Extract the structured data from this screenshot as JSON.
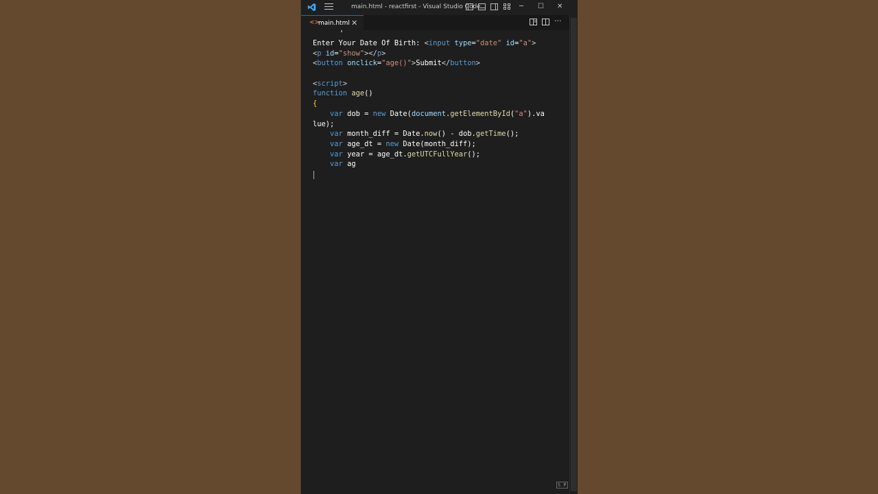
{
  "window": {
    "title": "main.html - reactfirst - Visual Studio Code",
    "controls": {
      "minimize": "─",
      "maximize": "☐",
      "close": "✕"
    }
  },
  "tab": {
    "icon": "<>",
    "label": "main.html",
    "close": "✕"
  },
  "editor_actions": [
    "open-preview-icon",
    "split-editor-icon",
    "more-actions-icon"
  ],
  "code": {
    "lines": [
      [
        {
          "t": "Enter Your Date Of Birth: ",
          "c": "text"
        },
        {
          "t": "<",
          "c": "tag"
        },
        {
          "t": "input",
          "c": "kw"
        },
        {
          "t": " type",
          "c": "attr"
        },
        {
          "t": "=",
          "c": "text"
        },
        {
          "t": "\"date\"",
          "c": "str"
        },
        {
          "t": " id",
          "c": "attr"
        },
        {
          "t": "=",
          "c": "text"
        },
        {
          "t": "\"a\"",
          "c": "str"
        },
        {
          "t": ">",
          "c": "tag"
        }
      ],
      [
        {
          "t": "<",
          "c": "tag"
        },
        {
          "t": "p",
          "c": "kw"
        },
        {
          "t": " id",
          "c": "attr"
        },
        {
          "t": "=",
          "c": "text"
        },
        {
          "t": "\"show\"",
          "c": "str"
        },
        {
          "t": "></",
          "c": "tag"
        },
        {
          "t": "p",
          "c": "kw"
        },
        {
          "t": ">",
          "c": "tag"
        }
      ],
      [
        {
          "t": "<",
          "c": "tag"
        },
        {
          "t": "button",
          "c": "kw"
        },
        {
          "t": " onclick",
          "c": "attr"
        },
        {
          "t": "=",
          "c": "text"
        },
        {
          "t": "\"age()\"",
          "c": "str"
        },
        {
          "t": ">",
          "c": "tag"
        },
        {
          "t": "Submit",
          "c": "text"
        },
        {
          "t": "</",
          "c": "tag"
        },
        {
          "t": "button",
          "c": "kw"
        },
        {
          "t": ">",
          "c": "tag"
        }
      ],
      [],
      [
        {
          "t": "<",
          "c": "tag"
        },
        {
          "t": "script",
          "c": "kw"
        },
        {
          "t": ">",
          "c": "tag"
        }
      ],
      [
        {
          "t": "function",
          "c": "kw"
        },
        {
          "t": " ",
          "c": "text"
        },
        {
          "t": "age",
          "c": "fn"
        },
        {
          "t": "()",
          "c": "text"
        }
      ],
      [
        {
          "t": "{",
          "c": "brace"
        }
      ],
      [
        {
          "t": "    ",
          "c": "text"
        },
        {
          "t": "var",
          "c": "kw"
        },
        {
          "t": " dob = ",
          "c": "text"
        },
        {
          "t": "new",
          "c": "kw"
        },
        {
          "t": " Date(",
          "c": "text"
        },
        {
          "t": "document",
          "c": "attr"
        },
        {
          "t": ".",
          "c": "text"
        },
        {
          "t": "getElementById",
          "c": "fn"
        },
        {
          "t": "(",
          "c": "text"
        },
        {
          "t": "\"a\"",
          "c": "str"
        },
        {
          "t": ").va",
          "c": "text"
        }
      ],
      [
        {
          "t": "lue);",
          "c": "text"
        }
      ],
      [
        {
          "t": "    ",
          "c": "text"
        },
        {
          "t": "var",
          "c": "kw"
        },
        {
          "t": " month_diff = Date.",
          "c": "text"
        },
        {
          "t": "now",
          "c": "fn"
        },
        {
          "t": "() - dob.",
          "c": "text"
        },
        {
          "t": "getTime",
          "c": "fn"
        },
        {
          "t": "();",
          "c": "text"
        }
      ],
      [
        {
          "t": "    ",
          "c": "text"
        },
        {
          "t": "var",
          "c": "kw"
        },
        {
          "t": " age_dt = ",
          "c": "text"
        },
        {
          "t": "new",
          "c": "kw"
        },
        {
          "t": " Date(month_diff);",
          "c": "text"
        }
      ],
      [
        {
          "t": "    ",
          "c": "text"
        },
        {
          "t": "var",
          "c": "kw"
        },
        {
          "t": " year = age_dt.",
          "c": "text"
        },
        {
          "t": "getUTCFullYear",
          "c": "fn"
        },
        {
          "t": "();",
          "c": "text"
        }
      ],
      [
        {
          "t": "    ",
          "c": "text"
        },
        {
          "t": "var",
          "c": "kw"
        },
        {
          "t": " ag",
          "c": "text"
        }
      ]
    ]
  },
  "overlay_badge": "S P",
  "colors": {
    "accent": "#0078d4",
    "editor_bg": "#1e1e1e",
    "desktop_bg": "#64492e"
  }
}
